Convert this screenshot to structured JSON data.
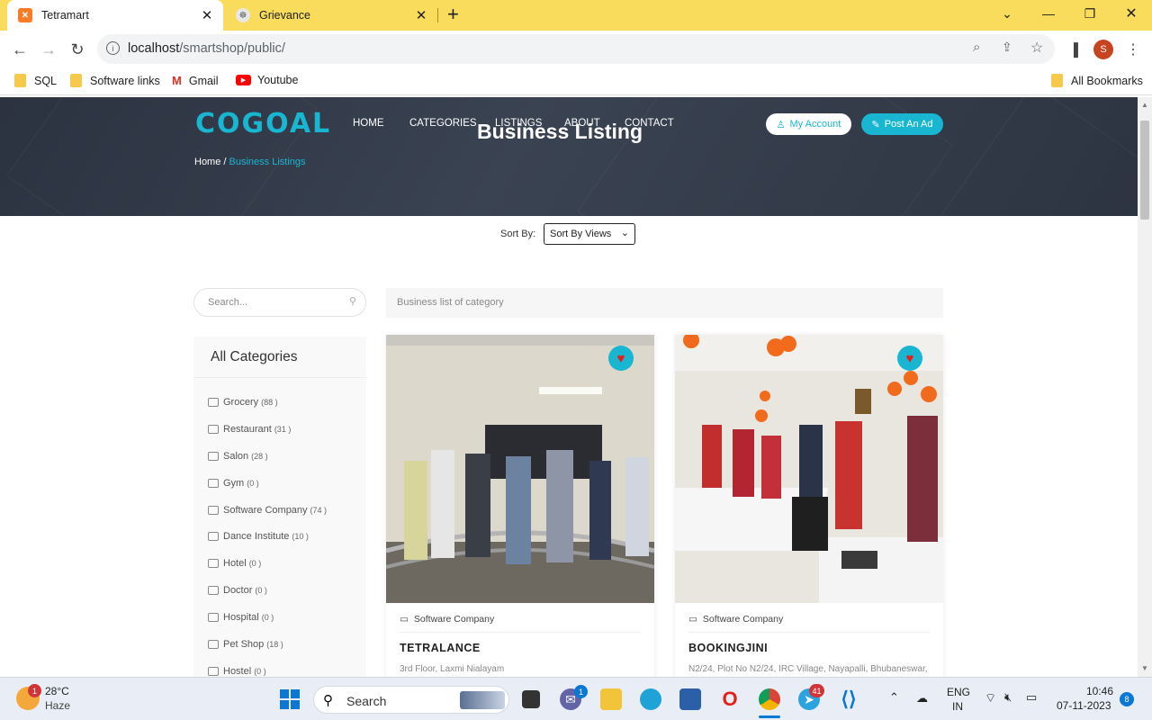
{
  "browser": {
    "tabs": [
      {
        "title": "Tetramart",
        "favicon": "xampp-icon",
        "active": true
      },
      {
        "title": "Grievance",
        "favicon": "emblem-icon",
        "active": false
      }
    ],
    "new_tab": "+",
    "url_host": "localhost",
    "url_path": "/smartshop/public/",
    "profile_initial": "S",
    "bookmarks": [
      {
        "label": "SQL",
        "icon": "folder-icon"
      },
      {
        "label": "Software links",
        "icon": "folder-icon"
      },
      {
        "label": "Gmail",
        "icon": "gmail-icon"
      },
      {
        "label": "Youtube",
        "icon": "youtube-icon"
      }
    ],
    "all_bookmarks": "All Bookmarks"
  },
  "site": {
    "logo": "COGOAL",
    "menu": [
      "HOME",
      "CATEGORIES",
      "LISTINGS",
      "ABOUT",
      "CONTACT"
    ],
    "page_title": "Business Listing",
    "my_account": "My Account",
    "post_ad": "Post An Ad",
    "breadcrumb_home": "Home /",
    "breadcrumb_current": "Business Listings",
    "accent_color": "#19b6d2"
  },
  "sort": {
    "label": "Sort By:",
    "selected": "Sort By Views"
  },
  "search": {
    "placeholder": "Search..."
  },
  "list_header": "Business list of category",
  "categories": {
    "title": "All Categories",
    "items": [
      {
        "name": "Grocery",
        "count": "(88 )",
        "icon": "basket-icon"
      },
      {
        "name": "Restaurant",
        "count": "(31 )",
        "icon": "restaurant-icon"
      },
      {
        "name": "Salon",
        "count": "(28 )",
        "icon": "salon-icon"
      },
      {
        "name": "Gym",
        "count": "(0 )",
        "icon": "gym-icon"
      },
      {
        "name": "Software Company",
        "count": "(74 )",
        "icon": "monitor-icon"
      },
      {
        "name": "Dance Institute",
        "count": "(10 )",
        "icon": "dance-icon"
      },
      {
        "name": "Hotel",
        "count": "(0 )",
        "icon": "fork-knife-icon"
      },
      {
        "name": "Doctor",
        "count": "(0 )",
        "icon": "doctor-icon"
      },
      {
        "name": "Hospital",
        "count": "(0 )",
        "icon": "hospital-icon"
      },
      {
        "name": "Pet Shop",
        "count": "(18 )",
        "icon": "pet-icon"
      },
      {
        "name": "Hostel",
        "count": "(0 )",
        "icon": "home-icon"
      }
    ]
  },
  "listings": [
    {
      "category": "Software Company",
      "name": "TETRALANCE",
      "address": "3rd Floor, Laxmi Nialayam"
    },
    {
      "category": "Software Company",
      "name": "BOOKINGJINI",
      "address": "N2/24, Plot No N2/24, IRC Village, Nayapalli, Bhubaneswar,"
    }
  ],
  "taskbar": {
    "weather_temp": "28°C",
    "weather_desc": "Haze",
    "weather_badge": "1",
    "search_label": "Search",
    "teams_badge": "1",
    "telegram_badge": "41",
    "lang_top": "ENG",
    "lang_bottom": "IN",
    "time": "10:46",
    "date": "07-11-2023",
    "notif_count": "8"
  }
}
